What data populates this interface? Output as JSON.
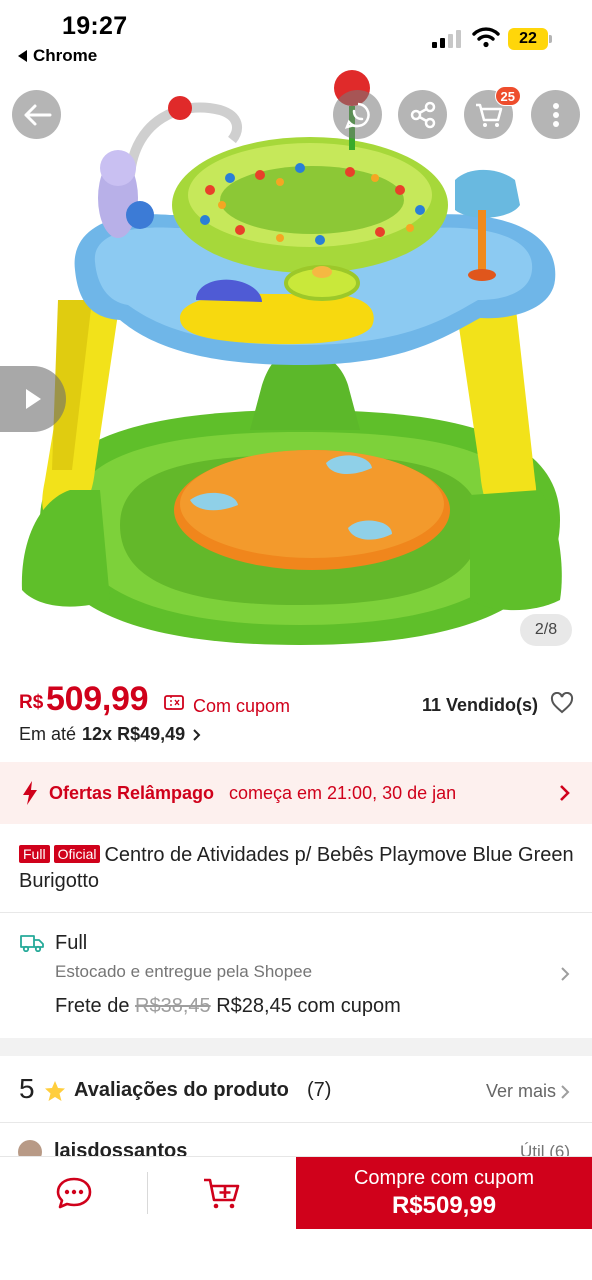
{
  "status_bar": {
    "time": "19:27",
    "back_app": "Chrome",
    "battery": "22"
  },
  "header": {
    "cart_count": "25"
  },
  "gallery": {
    "counter": "2/8"
  },
  "price": {
    "currency": "R$",
    "value": "509,99",
    "coupon_label": "Com cupom",
    "sold": "11 Vendido(s)",
    "installment_prefix": "Em até",
    "installment_value": "12x R$49,49"
  },
  "flash_sale": {
    "title": "Ofertas Relâmpago",
    "time_text": "começa em 21:00, 30 de jan"
  },
  "product": {
    "tag_full": "Full",
    "tag_official": "Oficial",
    "title": "Centro de Atividades p/ Bebês Playmove Blue Green Burigotto"
  },
  "shipping": {
    "title": "Full",
    "subtitle": "Estocado e entregue pela Shopee",
    "fee_prefix": "Frete de",
    "fee_old": "R$38,45",
    "fee_new": "R$28,45 com cupom"
  },
  "reviews": {
    "rating": "5",
    "title": "Avaliações do produto",
    "count": "(7)",
    "see_more": "Ver mais",
    "first_reviewer": "laisdossantos",
    "helpful": "Útil (6)"
  },
  "bottom_bar": {
    "buy_label": "Compre com cupom",
    "buy_price": "R$509,99"
  },
  "colors": {
    "brand_red": "#d0011b",
    "shopee_orange": "#ee4d2d",
    "flash_bg": "#fdf0ee"
  }
}
